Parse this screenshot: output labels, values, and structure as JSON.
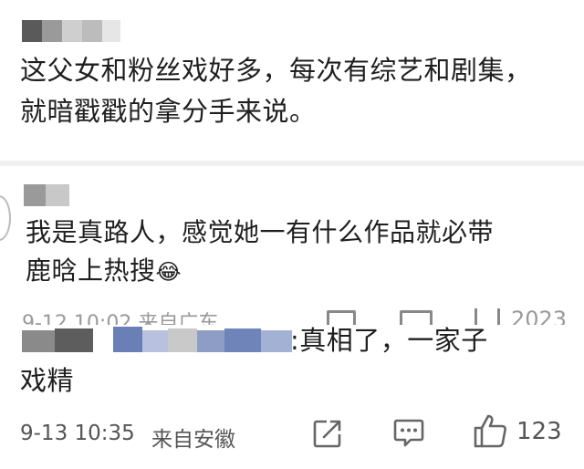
{
  "comment1": {
    "text_line1": "这父女和粉丝戏好多，每次有综艺和剧集，",
    "text_line2": "就暗戳戳的拿分手来说。"
  },
  "comment2": {
    "text_line1": "我是真路人，感觉她一有什么作品就必带",
    "text_line2": "鹿晗上热搜",
    "emoji": "😂",
    "meta_partial": "9-12 10:02  来自广东",
    "like_count_partial": "2023"
  },
  "reply": {
    "text_suffix": ":真相了，一家子",
    "text_line2": "戏精",
    "date": "9-13 10:35",
    "location": "来自安徽",
    "like_count": "123"
  },
  "icons": {
    "share": "share-icon",
    "comment": "comment-icon",
    "like": "thumbs-up-icon"
  },
  "colors": {
    "blur_gray": "#b9b9b9",
    "blur_dark": "#555555",
    "blur_blue": "#6f84b8",
    "text": "#1f1f1f",
    "meta": "#555555",
    "divider": "#f0f0f0"
  }
}
